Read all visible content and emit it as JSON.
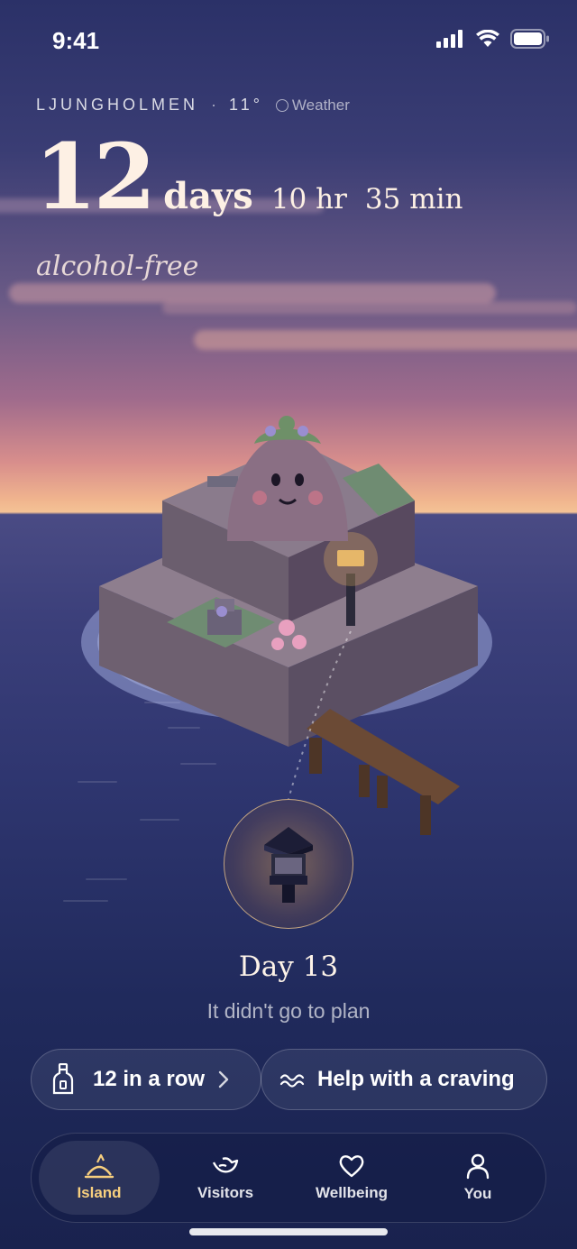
{
  "status_bar": {
    "time": "9:41"
  },
  "header": {
    "location": "LJUNGHOLMEN",
    "separator": "·",
    "temperature": "11°",
    "weather_label": "Weather"
  },
  "counter": {
    "days_value": "12",
    "days_unit": "days",
    "hours_text": "10 hr",
    "minutes_text": "35 min",
    "subtitle": "alcohol-free"
  },
  "milestone": {
    "day_title": "Day 13",
    "message": "It didn't go to plan"
  },
  "actions": {
    "streak_label": "12 in a row",
    "craving_label": "Help with a craving"
  },
  "nav": {
    "items": [
      {
        "label": "Island",
        "icon": "island-icon",
        "active": true
      },
      {
        "label": "Visitors",
        "icon": "bird-icon",
        "active": false
      },
      {
        "label": "Wellbeing",
        "icon": "heart-icon",
        "active": false
      },
      {
        "label": "You",
        "icon": "person-icon",
        "active": false
      }
    ]
  },
  "colors": {
    "accent": "#f7cf7e",
    "sky_top": "#2b3168",
    "horizon": "#f4c295",
    "sea": "#2f3670"
  }
}
